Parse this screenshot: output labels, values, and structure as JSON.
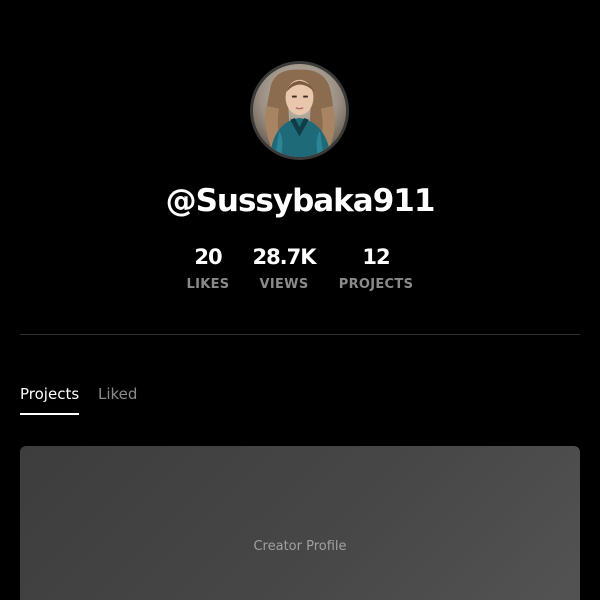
{
  "profile": {
    "avatar_icon": "profile-photo",
    "username": "@Sussybaka911"
  },
  "stats": {
    "likes": {
      "value": "20",
      "label": "LIKES"
    },
    "views": {
      "value": "28.7K",
      "label": "VIEWS"
    },
    "projects": {
      "value": "12",
      "label": "PROJECTS"
    }
  },
  "tabs": [
    {
      "label": "Projects",
      "active": true
    },
    {
      "label": "Liked",
      "active": false
    }
  ],
  "projects": [
    {
      "title": "Creator Profile"
    }
  ],
  "colors": {
    "background": "#000000",
    "text_primary": "#ffffff",
    "text_muted": "#8a8a8a",
    "divider": "#2e2e2e",
    "card": "#444444"
  }
}
